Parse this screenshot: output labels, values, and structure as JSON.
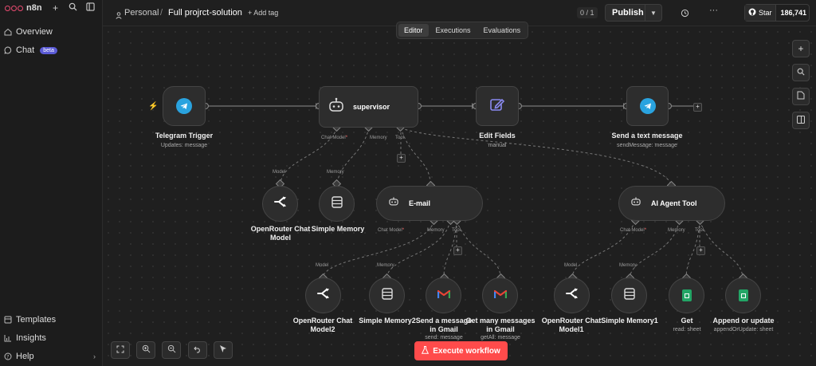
{
  "app": {
    "name": "n8n"
  },
  "sidebar": {
    "items": [
      {
        "label": "Overview",
        "icon": "home-icon"
      },
      {
        "label": "Chat",
        "icon": "chat-icon",
        "badge": "beta"
      }
    ],
    "bottom": [
      {
        "label": "Templates",
        "icon": "templates-icon"
      },
      {
        "label": "Insights",
        "icon": "insights-icon"
      },
      {
        "label": "Help",
        "icon": "help-icon"
      }
    ]
  },
  "header": {
    "project": "Personal",
    "separator": "/",
    "workflow_name": "Full projrct-solution",
    "add_tag": "+ Add tag",
    "version": "0 / 1",
    "publish": "Publish",
    "github_star": "Star",
    "github_count": "186,741"
  },
  "tabs": [
    {
      "label": "Editor",
      "active": true
    },
    {
      "label": "Executions",
      "active": false
    },
    {
      "label": "Evaluations",
      "active": false
    }
  ],
  "nodes": {
    "telegram_trigger": {
      "label": "Telegram Trigger",
      "sub": "Updates: message"
    },
    "supervisor": {
      "label": "supervisor"
    },
    "edit_fields": {
      "label": "Edit Fields",
      "sub": "manual"
    },
    "send_text": {
      "label": "Send a text message",
      "sub": "sendMessage: message"
    },
    "openrouter": {
      "label": "OpenRouter Chat Model"
    },
    "simple_memory": {
      "label": "Simple Memory"
    },
    "email": {
      "label": "E-mail"
    },
    "ai_agent_tool": {
      "label": "AI Agent Tool"
    },
    "openrouter2": {
      "label": "OpenRouter Chat Model2"
    },
    "simple_memory2": {
      "label": "Simple Memory2"
    },
    "send_message_gmail": {
      "label": "Send a message in Gmail",
      "sub": "send: message"
    },
    "get_many_gmail": {
      "label": "Get many messages in Gmail",
      "sub": "getAll: message"
    },
    "openrouter1": {
      "label": "OpenRouter Chat Model1"
    },
    "simple_memory1": {
      "label": "Simple Memory1"
    },
    "get_sheet": {
      "label": "Get",
      "sub": "read: sheet"
    },
    "append_update": {
      "label": "Append or update",
      "sub": "appendOrUpdate: sheet"
    }
  },
  "ports": {
    "chat_model": "Chat Model",
    "memory": "Memory",
    "tool": "Tool",
    "model": "Model",
    "required_mark": "*"
  },
  "execute_button": "Execute workflow",
  "colors": {
    "accent": "#ff4b4b",
    "telegram": "#2aa3df",
    "sheets": "#23a566",
    "gmail_red": "#ea4335",
    "beta_badge": "#5b5bd6"
  }
}
